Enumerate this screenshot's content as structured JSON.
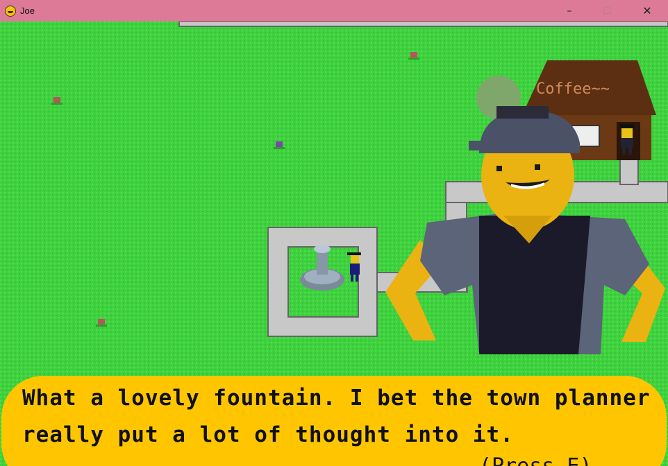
{
  "window": {
    "title": "Joe",
    "controls": {
      "minimize": "–",
      "maximize": "☐",
      "close": "✕"
    }
  },
  "scene": {
    "shop_sign": "Coffee~~"
  },
  "dialog": {
    "line1": "What a lovely fountain. I bet the town planner",
    "line2": "really put a lot of thought into it.",
    "prompt": "(Press E)"
  },
  "colors": {
    "titlebar": "#dc7a98",
    "grass": "#3fd13f",
    "path": "#c8c8c8",
    "dialog_box": "#ffc600",
    "skin": "#eab312",
    "apron": "#1a1a2a",
    "shirt": "#5b6478",
    "shop_roof": "#5c2f12"
  },
  "icons": [
    "app-icon",
    "flower-icon",
    "fountain-icon",
    "coffee-cup-icon"
  ]
}
